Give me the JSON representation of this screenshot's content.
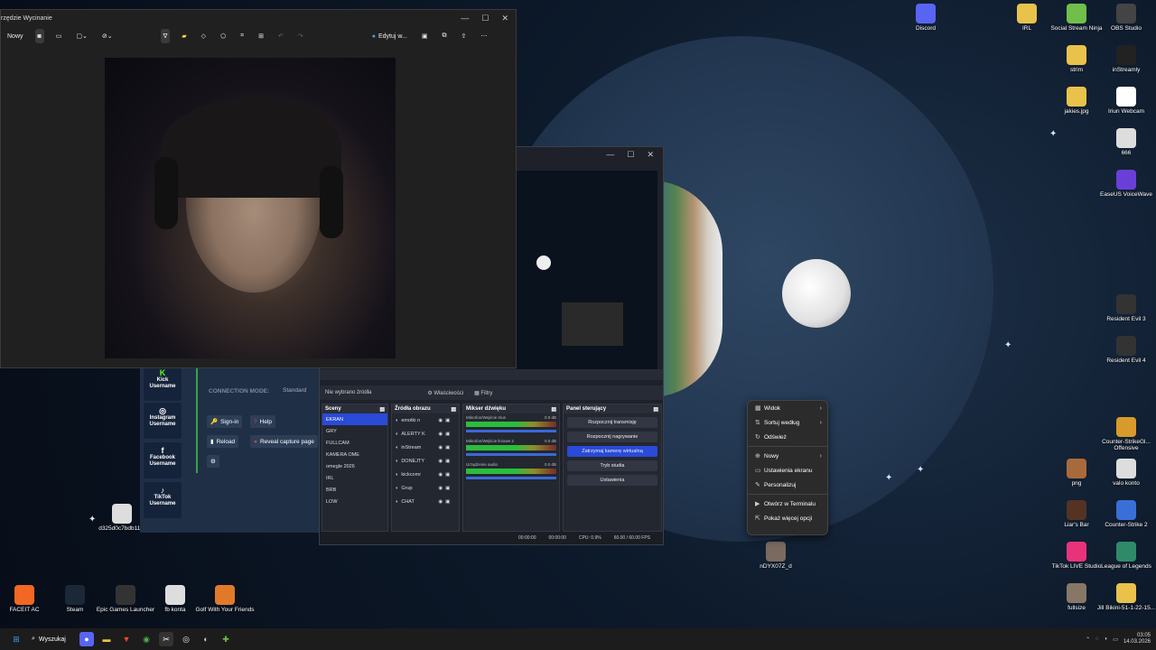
{
  "snipping_tool": {
    "title": "rzędzie Wycinanie",
    "new_label": "Nowy",
    "edit_label": "Edytuj w..."
  },
  "obs": {
    "no_source": "Nie wybrano źródła",
    "properties": "Właściwości",
    "filters": "Filtry",
    "scenes_title": "Sceny",
    "scenes": [
      "EKRAN",
      "GRY",
      "FULLCAM",
      "KAMERA OME",
      "omegle 2026",
      "IRL",
      "BRB",
      "LOW"
    ],
    "sources_title": "Źródła obrazu",
    "sources": [
      "emotki n",
      "ALERTY K",
      "inStream",
      "DONEJTY",
      "kickcomr",
      "Grup",
      "CHAT"
    ],
    "mixer_title": "Mikser dźwięku",
    "mixer_channels": [
      {
        "name": "Mikrofon/Wejście Iriun",
        "db": "0.0 dB"
      },
      {
        "name": "Mikrofon/Wejście liniowe 2",
        "db": "0.0 dB"
      },
      {
        "name": "Urządzenie audio",
        "db": "0.0 dB"
      }
    ],
    "controls_title": "Panel sterujący",
    "controls": [
      "Rozpocznij transmisję",
      "Rozpocznij nagrywanie",
      "Zatrzymaj kamerę wirtualną",
      "Tryb studia",
      "Ustawienia"
    ],
    "status": {
      "time1": "00:00:00",
      "time2": "00:00:00",
      "cpu": "CPU: 0.9%",
      "fps": "60.00 / 60.00 FPS"
    }
  },
  "stream_app": {
    "platforms": [
      {
        "name": "Kick Username"
      },
      {
        "name": "Instagram Username"
      },
      {
        "name": "Facebook Username"
      },
      {
        "name": "TikTok Username"
      }
    ],
    "connection_mode": "CONNECTION MODE:",
    "standard": "Standard",
    "sign_in": "Sign-in",
    "help": "Help",
    "reload": "Reload",
    "reveal": "Reveal capture page"
  },
  "context_menu": {
    "items": [
      {
        "label": "Widok",
        "submenu": true
      },
      {
        "label": "Sortuj według",
        "submenu": true
      },
      {
        "label": "Odśwież",
        "submenu": false
      },
      {
        "label": "Nowy",
        "submenu": true
      },
      {
        "label": "Ustawienia ekranu",
        "submenu": false
      },
      {
        "label": "Personalizuj",
        "submenu": false
      },
      {
        "label": "Otwórz w Terminalu",
        "submenu": false
      },
      {
        "label": "Pokaż więcej opcji",
        "submenu": false
      }
    ]
  },
  "desktop_right": [
    {
      "label": "Discord",
      "icon": "discord-icon",
      "color": "#5865f2"
    },
    {
      "label": "IRL",
      "icon": "folder-icon",
      "color": "#e8c24a"
    },
    {
      "label": "Social Stream Ninja",
      "icon": "ninja-icon",
      "color": "#6fbf4a"
    },
    {
      "label": "OBS Studio",
      "icon": "obs-icon",
      "color": "#444"
    },
    {
      "label": "strim",
      "icon": "folder-icon",
      "color": "#e8c24a"
    },
    {
      "label": "inStreamly",
      "icon": "instreamly-icon",
      "color": "#222"
    },
    {
      "label": "jakies.jpg",
      "icon": "folder-icon",
      "color": "#e8c24a"
    },
    {
      "label": "Iriun Webcam",
      "icon": "webcam-icon",
      "color": "#fff"
    },
    {
      "label": "666",
      "icon": "file-icon",
      "color": "#ddd"
    },
    {
      "label": "EaseUS VoiceWave",
      "icon": "voicewave-icon",
      "color": "#6a3fd8"
    },
    {
      "label": "Resident Evil 3",
      "icon": "game-icon",
      "color": "#333"
    },
    {
      "label": "Resident Evil 4",
      "icon": "game-icon",
      "color": "#333"
    },
    {
      "label": "Counter-StrikeGl... Offensive",
      "icon": "csgo-icon",
      "color": "#d89a2a"
    },
    {
      "label": "png",
      "icon": "image-icon",
      "color": "#a86a3a"
    },
    {
      "label": "valo konto",
      "icon": "file-icon",
      "color": "#ddd"
    },
    {
      "label": "Liar's Bar",
      "icon": "game-icon",
      "color": "#553322"
    },
    {
      "label": "Counter-Strike 2",
      "icon": "cs2-icon",
      "color": "#3a6fd8"
    },
    {
      "label": "nDYX07Z_d",
      "icon": "image-icon",
      "color": "#7a6a60"
    },
    {
      "label": "TikTok LIVE Studio",
      "icon": "tiktok-icon",
      "color": "#e8337a"
    },
    {
      "label": "League of Legends",
      "icon": "lol-icon",
      "color": "#2f8a6a"
    },
    {
      "label": "fullsize",
      "icon": "image-icon",
      "color": "#887766"
    },
    {
      "label": "Jill Bikini-51-1-22-15...",
      "icon": "folder-icon",
      "color": "#e8c24a"
    }
  ],
  "desktop_bottom": [
    {
      "label": "FACEIT AC",
      "icon": "faceit-icon",
      "color": "#f26722"
    },
    {
      "label": "Steam",
      "icon": "steam-icon",
      "color": "#1b2838"
    },
    {
      "label": "Epic Games Launcher",
      "icon": "epic-icon",
      "color": "#333"
    },
    {
      "label": "fb konta",
      "icon": "file-icon",
      "color": "#ddd"
    },
    {
      "label": "Golf With Your Friends",
      "icon": "golf-icon",
      "color": "#e07a2a"
    },
    {
      "label": "d325d0c7bdb11...",
      "icon": "file-icon",
      "color": "#ddd"
    }
  ],
  "taskbar": {
    "search_label": "Wyszukaj",
    "time": "03:05",
    "date": "14.03.2026"
  }
}
